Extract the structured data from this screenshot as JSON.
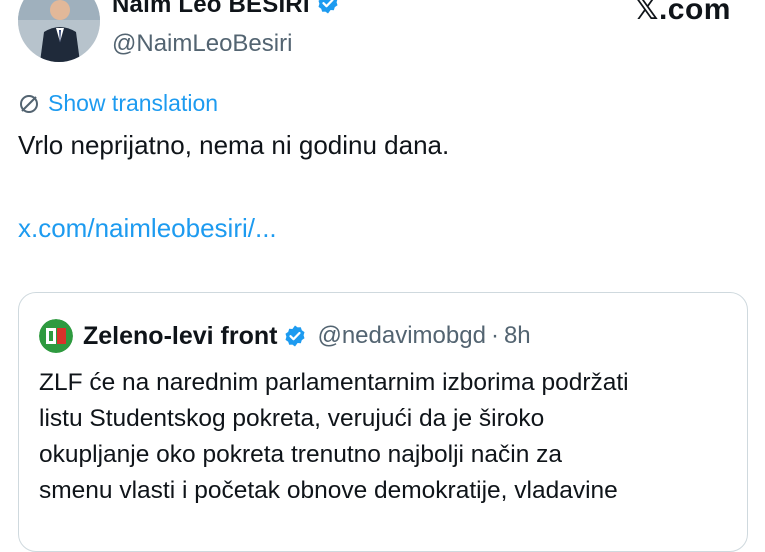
{
  "colors": {
    "accent": "#1d9bf0",
    "text": "#0f1419",
    "muted": "#536471",
    "border": "#cfd9de",
    "quote_logo_green": "#2e9a3f",
    "quote_logo_red": "#d9312a"
  },
  "header": {
    "display_name": "Naim Leo BESIRI",
    "handle": "@NaimLeoBesiri",
    "brand": "𝕏.com",
    "verified_icon": "verified-badge-icon"
  },
  "tweet": {
    "translate_label": "Show translation",
    "translate_icon": "globe-icon",
    "text": "Vrlo neprijatno, nema ni godinu dana.",
    "link": "x.com/naimleobesiri/..."
  },
  "quote": {
    "name": "Zeleno-levi front",
    "handle": "@nedavimobgd",
    "separator": "·",
    "time": "8h",
    "lines": [
      "ZLF će na narednim parlamentarnim izborima podržati",
      "listu Studentskog pokreta, verujući da je široko",
      "okupljanje oko pokreta trenutno najbolji način za",
      "smenu vlasti i početak obnove demokratije, vladavine"
    ]
  }
}
